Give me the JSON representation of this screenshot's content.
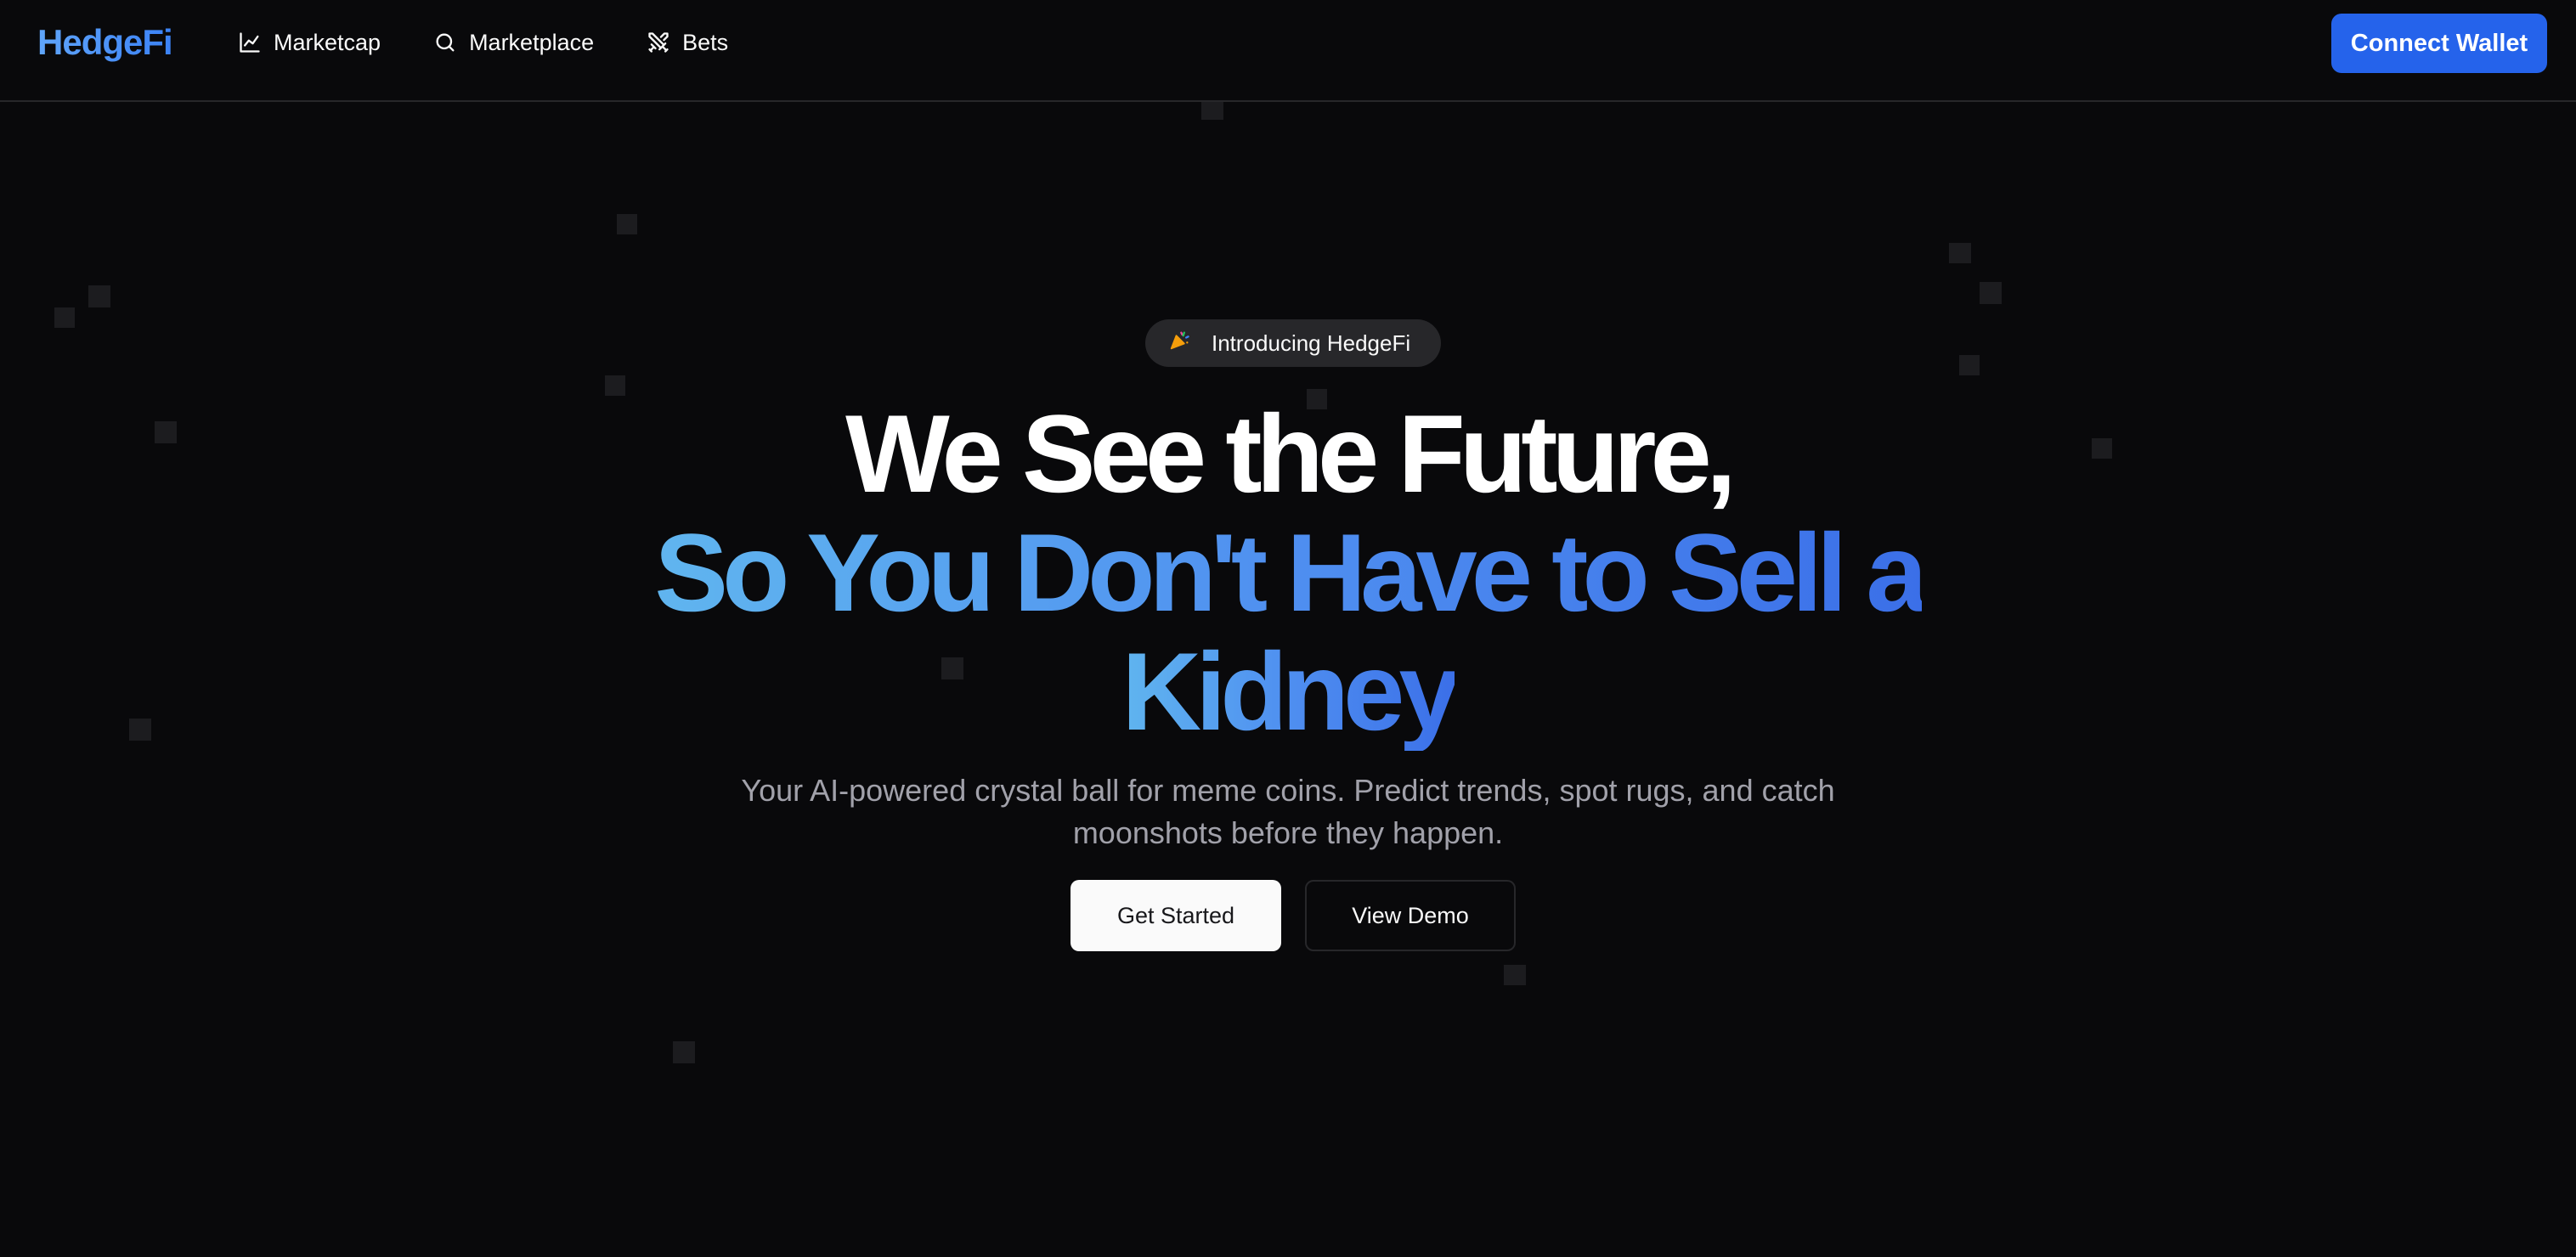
{
  "header": {
    "logo": "HedgeFi",
    "nav": [
      {
        "label": "Marketcap",
        "icon": "chart-line-icon"
      },
      {
        "label": "Marketplace",
        "icon": "search-icon"
      },
      {
        "label": "Bets",
        "icon": "swords-icon"
      }
    ],
    "connect_label": "Connect Wallet"
  },
  "hero": {
    "badge_icon": "party-popper-icon",
    "badge_text": "Introducing HedgeFi",
    "headline_line1": "We See the Future,",
    "headline_line2": "So You Don't Have to Sell a",
    "headline_line3": "Kidney",
    "subtitle_line1": "Your AI-powered crystal ball for meme coins. Predict trends, spot rugs, and catch",
    "subtitle_line2": "moonshots before they happen.",
    "primary_cta": "Get Started",
    "secondary_cta": "View Demo"
  },
  "colors": {
    "background": "#09090b",
    "accent": "#2563eb",
    "gradient_start": "#60b5ef",
    "gradient_end": "#3b6fe8",
    "muted_text": "#a1a1aa"
  }
}
